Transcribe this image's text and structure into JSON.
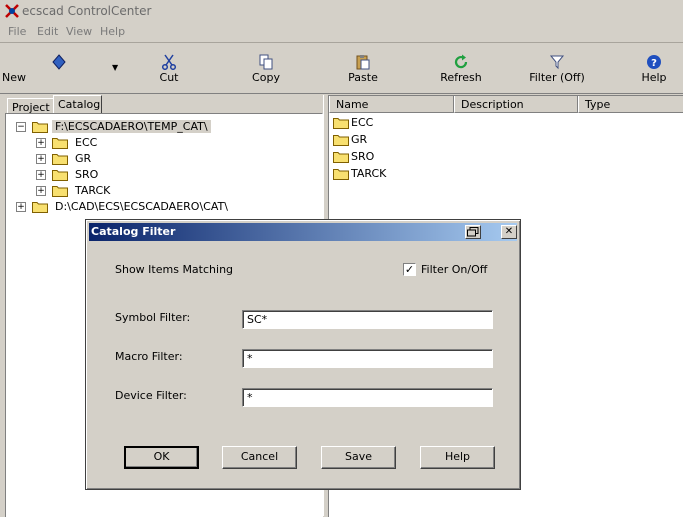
{
  "window": {
    "title": "ecscad ControlCenter"
  },
  "menu": [
    "File",
    "Edit",
    "View",
    "Help"
  ],
  "toolbar": {
    "new": "New",
    "cut": "Cut",
    "copy": "Copy",
    "paste": "Paste",
    "refresh": "Refresh",
    "filter": "Filter (Off)",
    "help": "Help"
  },
  "left_tabs": [
    "Project",
    "Catalog"
  ],
  "tree": {
    "root1": "F:\\ECSCADAERO\\TEMP_CAT\\",
    "children": [
      "ECC",
      "GR",
      "SRO",
      "TARCK"
    ],
    "root2": "D:\\CAD\\ECS\\ECSCADAERO\\CAT\\"
  },
  "columns": [
    "Name",
    "Description",
    "Type"
  ],
  "files": [
    "ECC",
    "GR",
    "SRO",
    "TARCK"
  ],
  "dialog": {
    "title": "Catalog Filter",
    "show_items": "Show Items Matching",
    "filter_toggle": "Filter On/Off",
    "filter_checked": true,
    "symbol_label": "Symbol Filter:",
    "symbol_value": "SC*",
    "macro_label": "Macro Filter:",
    "macro_value": "*",
    "device_label": "Device Filter:",
    "device_value": "*",
    "ok": "OK",
    "cancel": "Cancel",
    "save": "Save",
    "help": "Help"
  },
  "colors": {
    "title_gradient_start": "#0a246a",
    "title_gradient_end": "#a6caf0",
    "selection": "#d4d0c8"
  }
}
